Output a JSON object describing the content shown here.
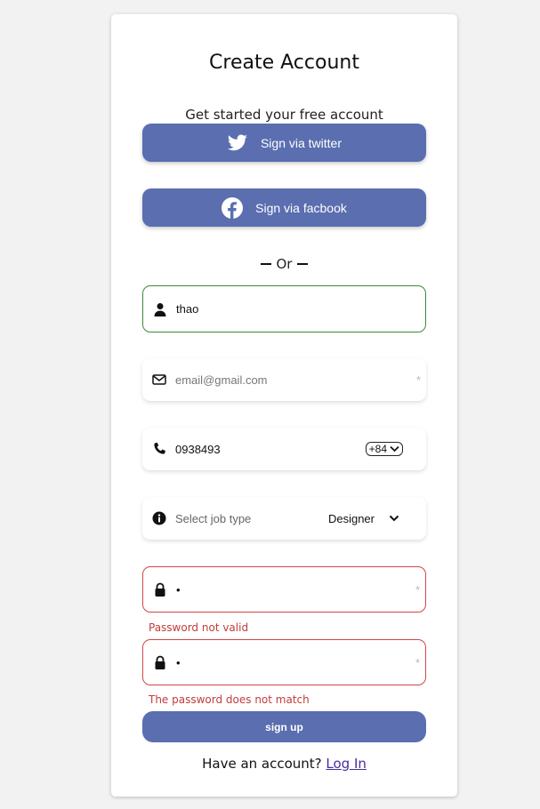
{
  "form": {
    "title": "Create Account",
    "subtitle": "Get started your free account",
    "twitter_label": "Sign via twitter",
    "facebook_label": "Sign via facbook",
    "or_text": "Or",
    "name_value": "thao",
    "email_placeholder": "email@gmail.com",
    "phone_value": "0938493",
    "phone_code": "+84",
    "job_label": "Select job type",
    "job_value": "Designer",
    "password_value": "•",
    "password_error": "Password not valid",
    "confirm_value": "•",
    "confirm_error": "The password does not match",
    "required_mark": "*",
    "signup_label": "sign up",
    "account_prompt": "Have an account?",
    "login_label": "Log In"
  },
  "icons": {
    "twitter": "twitter-icon",
    "facebook": "facebook-icon",
    "name": "user-icon",
    "email": "envelope-icon",
    "phone": "phone-icon",
    "job": "info-icon",
    "password": "lock-icon",
    "confirm": "lock-icon"
  },
  "colors": {
    "primary": "#5a6eb0",
    "valid_border": "#3b8a3b",
    "error": "#c23b3b",
    "link": "#4a2ca0"
  }
}
